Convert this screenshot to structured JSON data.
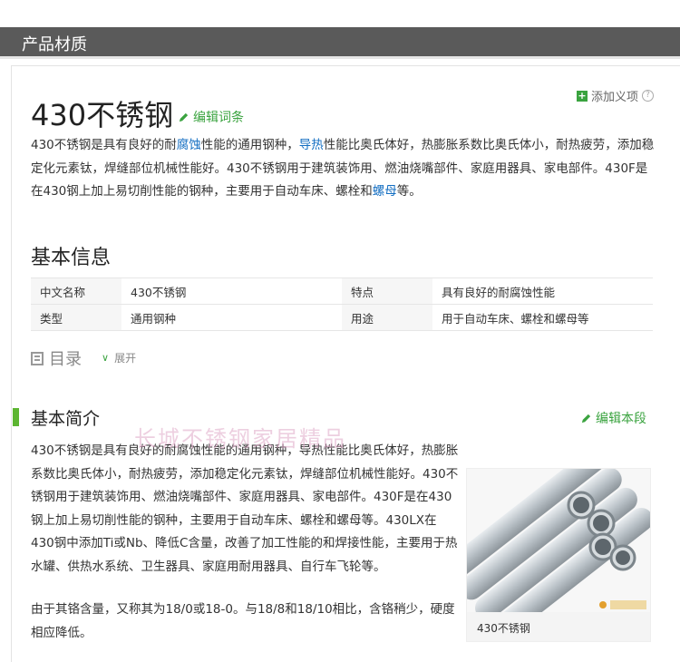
{
  "section_header": {
    "title": "产品材质"
  },
  "toolbar": {
    "add_entry_label": "添加义项",
    "help_glyph": "?"
  },
  "entry": {
    "title": "430不锈钢",
    "edit_label": "编辑词条",
    "intro": {
      "p1": "430不锈钢是具有良好的耐",
      "link1": "腐蚀",
      "p2": "性能的通用钢种，",
      "link2": "导热",
      "p3": "性能比奥氏体好，热膨胀系数比奥氏体小，耐热疲劳，添加稳定化元素钛，焊缝部位机械性能好。430不锈钢用于建筑装饰用、燃油烧嘴部件、家庭用器具、家电部件。430F是在430钢上加上易切削性能的钢种，主要用于自动车床、螺栓和",
      "link3": "螺母",
      "p4": "等。"
    }
  },
  "basic_info": {
    "heading": "基本信息",
    "rows": [
      {
        "k1": "中文名称",
        "v1": "430不锈钢",
        "k2": "特点",
        "v2": "具有良好的耐腐蚀性能"
      },
      {
        "k1": "类型",
        "v1": "通用钢种",
        "k2": "用途",
        "v2": "用于自动车床、螺栓和螺母等"
      }
    ]
  },
  "toc": {
    "label": "目录",
    "expand_label": "展开"
  },
  "summary": {
    "heading": "基本简介",
    "edit_label": "编辑本段",
    "watermark": "长城不锈钢家居精品",
    "para1": "430不锈钢是具有良好的耐腐蚀性能的通用钢种，导热性能比奥氏体好，热膨胀系数比奥氏体小，耐热疲劳，添加稳定化元素钛，焊缝部位机械性能好。430不锈钢用于建筑装饰用、燃油烧嘴部件、家庭用器具、家电部件。430F是在430钢上加上易切削性能的钢种，主要用于自动车床、螺栓和螺母等。430LX在430钢中添加Ti或Nb、降低C含量，改善了加工性能的和焊接性能，主要用于热水罐、供热水系统、卫生器具、家庭用耐用器具、自行车飞轮等。",
    "para2": "由于其铬含量，又称其为18/0或18-0。与18/8和18/10相比，含铬稍少，硬度相应降低。",
    "image_caption": "430不锈钢"
  },
  "colors": {
    "accent_green": "#3aa33f",
    "link_blue": "#136ec2",
    "header_bg": "#5a5a5a"
  }
}
